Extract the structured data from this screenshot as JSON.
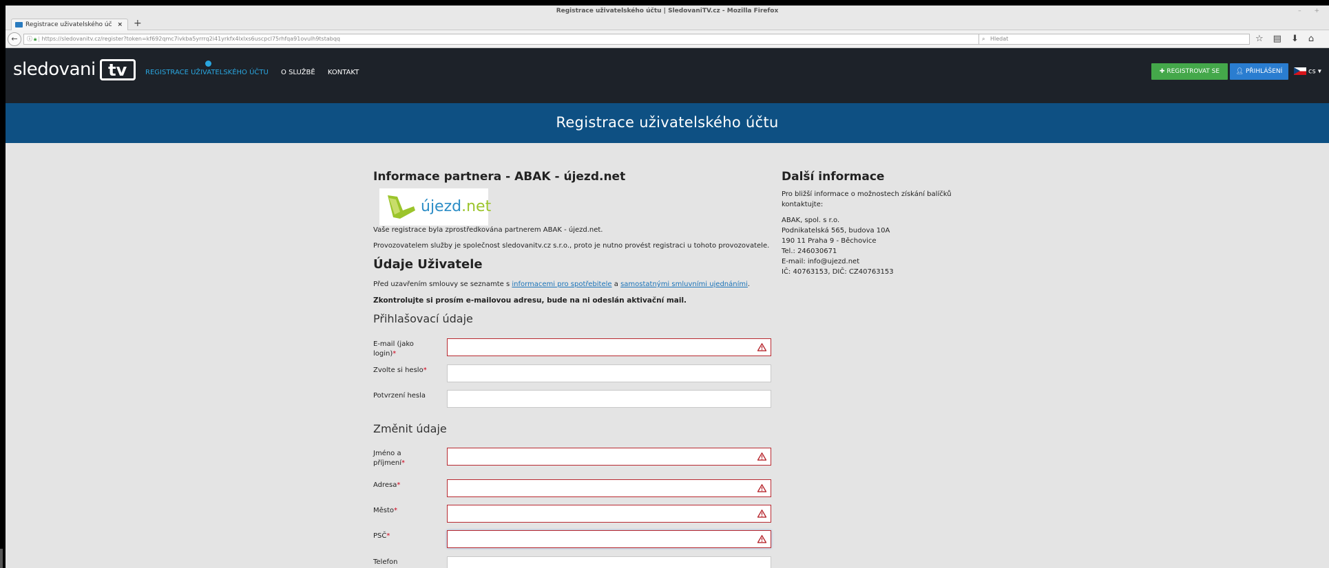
{
  "browser": {
    "window_title": "Registrace uživatelského účtu | SledovaniTV.cz - Mozilla Firefox",
    "window_controls": "– +",
    "tab_title": "Registrace uživatelského úč",
    "tab_close": "×",
    "new_tab": "+",
    "url_host": "https://sledovanitv.cz",
    "url_path": "/register?token=kf692qmc7ivkba5yrrrq2i41yrkfx4lxlxs6uscpcl75rhfqa91ovulh9tstabqq",
    "search_placeholder": "Hledat"
  },
  "site": {
    "logo_word": "sledovani",
    "logo_tv": "tv",
    "nav": [
      "REGISTRACE UŽIVATELSKÉHO ÚČTU",
      "O SLUŽBĚ",
      "KONTAKT"
    ],
    "register_button": "REGISTROVAT SE",
    "login_button": "PŘIHLÁŠENÍ",
    "language": "cs"
  },
  "banner_title": "Registrace uživatelského účtu",
  "partner": {
    "heading": "Informace partnera - ABAK - újezd.net",
    "logo_text_main": "újezd",
    "logo_text_suffix": ".net",
    "line1": "Vaše registrace byla zprostředkována partnerem ABAK - újezd.net.",
    "line2": "Provozovatelem služby je společnost sledovanitv.cz s.r.o., proto je nutno provést registraci u tohoto provozovatele."
  },
  "user": {
    "heading": "Údaje Uživatele",
    "terms_prefix": "Před uzavřením smlouvy se seznamte s ",
    "terms_link1": "informacemi pro spotřebitele",
    "terms_mid": " a ",
    "terms_link2": "samostatnými smluvními ujednáními",
    "terms_suffix": ".",
    "notice": "Zkontrolujte si prosím e-mailovou adresu, bude na ni odeslán aktivační mail."
  },
  "login_section": {
    "heading": "Přihlašovací údaje",
    "fields": [
      {
        "label": "E-mail (jako login)",
        "required": "*",
        "value": ""
      },
      {
        "label": "Zvolte si heslo",
        "required": "*",
        "value": ""
      },
      {
        "label": "Potvrzení hesla",
        "required": "",
        "value": ""
      }
    ]
  },
  "change_section": {
    "heading": "Změnit údaje",
    "fields": [
      {
        "label": "Jméno a příjmení",
        "required": "*",
        "value": ""
      },
      {
        "label": "Adresa",
        "required": "*",
        "value": ""
      },
      {
        "label": "Město",
        "required": "*",
        "value": ""
      },
      {
        "label": "PSČ",
        "required": "*",
        "value": ""
      },
      {
        "label": "Telefon",
        "required": "",
        "value": ""
      }
    ]
  },
  "info": {
    "heading": "Další informace",
    "intro": "Pro bližší informace o možnostech získání balíčků kontaktujte:",
    "lines": [
      "ABAK, spol. s r.o.",
      "Podnikatelská 565, budova 10A",
      "190 11 Praha 9 - Běchovice",
      "Tel.: 246030671",
      "E-mail: info@ujezd.net",
      "IČ: 40763153, DIČ: CZ40763153"
    ]
  },
  "colors": {
    "header_bg": "#1d2229",
    "banner_bg": "#0e5083",
    "accent": "#2aa6df",
    "register_green": "#44a84a",
    "login_blue": "#2a7dd0",
    "error_red": "#b7282f"
  }
}
